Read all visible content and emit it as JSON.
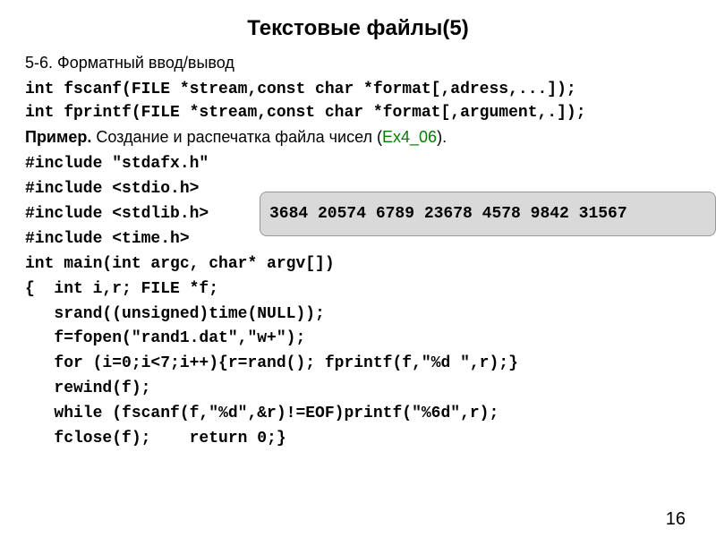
{
  "title": "Текстовые файлы(5)",
  "section": "5-6. Форматный ввод/вывод",
  "sig1": "int fscanf(FILE *stream,const char *format[,adress,...]);",
  "sig2": "int fprintf(FILE *stream,const char *format[,argument,.]);",
  "example_label": "Пример.",
  "example_text": " Создание и распечатка  файла чисел (",
  "example_link": "Ex4_06",
  "example_tail": ").",
  "output": " 3684 20574  6789 23678  4578  9842 31567",
  "code": "#include \"stdafx.h\"\n#include <stdio.h>\n#include <stdlib.h>\n#include <time.h>\nint main(int argc, char* argv[])\n{  int i,r; FILE *f;\n   srand((unsigned)time(NULL));\n   f=fopen(\"rand1.dat\",\"w+\");\n   for (i=0;i<7;i++){r=rand(); fprintf(f,\"%d \",r);}\n   rewind(f);\n   while (fscanf(f,\"%d\",&r)!=EOF)printf(\"%6d\",r);\n   fclose(f);    return 0;}",
  "page": "16"
}
